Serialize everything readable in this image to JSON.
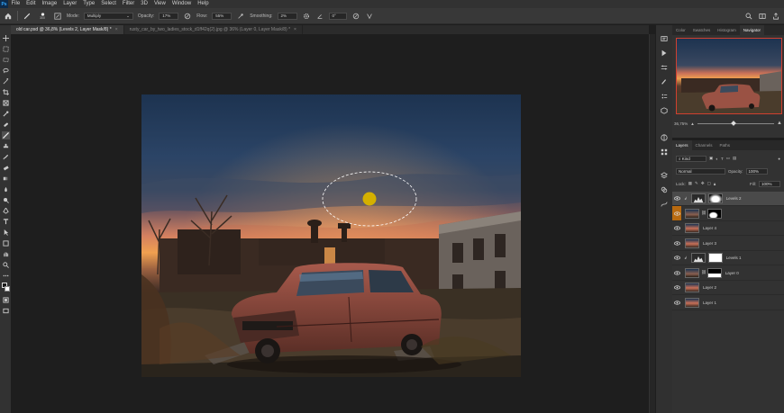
{
  "menu": [
    "File",
    "Edit",
    "Image",
    "Layer",
    "Type",
    "Select",
    "Filter",
    "3D",
    "View",
    "Window",
    "Help"
  ],
  "app_logo": "Ps",
  "options": {
    "brush_size": "300",
    "mode_label": "Mode:",
    "mode_value": "Multiply",
    "opacity_label": "Opacity:",
    "opacity_value": "17%",
    "flow_label": "Flow:",
    "flow_value": "55%",
    "smoothing_label": "Smoothing:",
    "smoothing_value": "2%",
    "angle_value": "0°"
  },
  "tabs": [
    {
      "label": "old car.psd @ 36,8% (Levels 2, Layer Mask/8) *",
      "active": true
    },
    {
      "label": "rusty_car_by_two_ladies_stock_d1ff42q(2).jpg @ 36% (Layer 0, Layer Mask/8) *",
      "active": false
    }
  ],
  "top_panel": {
    "tabs": [
      "Color",
      "Swatches",
      "Histogram",
      "Navigator"
    ],
    "active_tab": "Navigator",
    "zoom": "36,75%"
  },
  "layers_panel": {
    "tabs": [
      "Layers",
      "Channels",
      "Paths"
    ],
    "active_tab": "Layers",
    "filter": "Kind",
    "blend_mode": "Normal",
    "opacity_label": "Opacity:",
    "opacity_value": "100%",
    "lock_label": "Lock:",
    "fill_label": "Fill:",
    "fill_value": "100%",
    "layers": [
      {
        "name": "Levels 2",
        "type": "adjustment",
        "selected": true
      },
      {
        "name": "",
        "type": "masked",
        "selected": false
      },
      {
        "name": "Layer 4",
        "type": "pixel",
        "selected": false
      },
      {
        "name": "Layer 3",
        "type": "pixel",
        "selected": false
      },
      {
        "name": "Levels 1",
        "type": "adjustment",
        "selected": false
      },
      {
        "name": "Layer 0",
        "type": "masked",
        "selected": false
      },
      {
        "name": "Layer 2",
        "type": "pixel",
        "selected": false
      },
      {
        "name": "Layer 1",
        "type": "pixel",
        "selected": false
      }
    ]
  },
  "colors": {
    "accent": "#31a8ff",
    "selection_dot": "#d4b000",
    "navigator_frame": "#d04030"
  }
}
